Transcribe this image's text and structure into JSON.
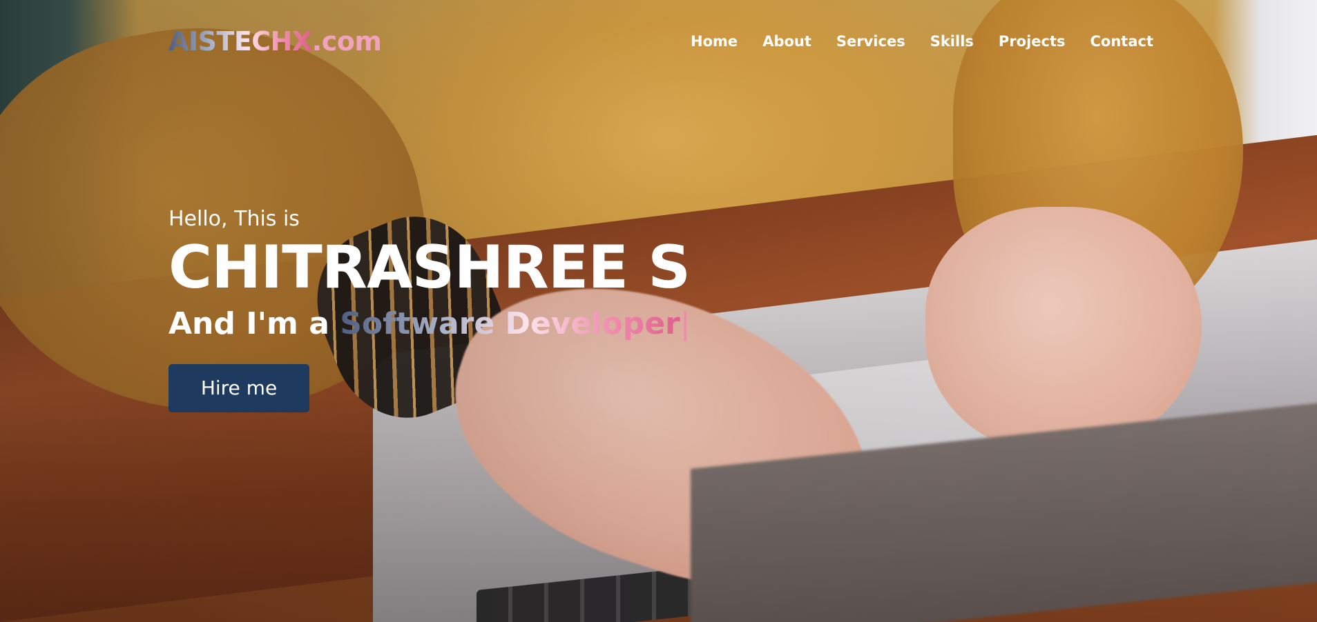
{
  "header": {
    "logo_main": "AISTECHX",
    "logo_tld": ".com",
    "nav": [
      "Home",
      "About",
      "Services",
      "Skills",
      "Projects",
      "Contact"
    ]
  },
  "hero": {
    "greeting": "Hello, This is",
    "name": "CHITRASHREE S",
    "tagline_prefix": "And I'm a ",
    "role": "Software Developer",
    "cursor": "|",
    "cta_label": "Hire me"
  },
  "colors": {
    "button_bg": "#1f3a5f",
    "gradient_start": "#4f5e7f",
    "gradient_end": "#e05e8e",
    "text": "#ffffff"
  },
  "background": {
    "image": "hands-typing-on-laptop"
  }
}
